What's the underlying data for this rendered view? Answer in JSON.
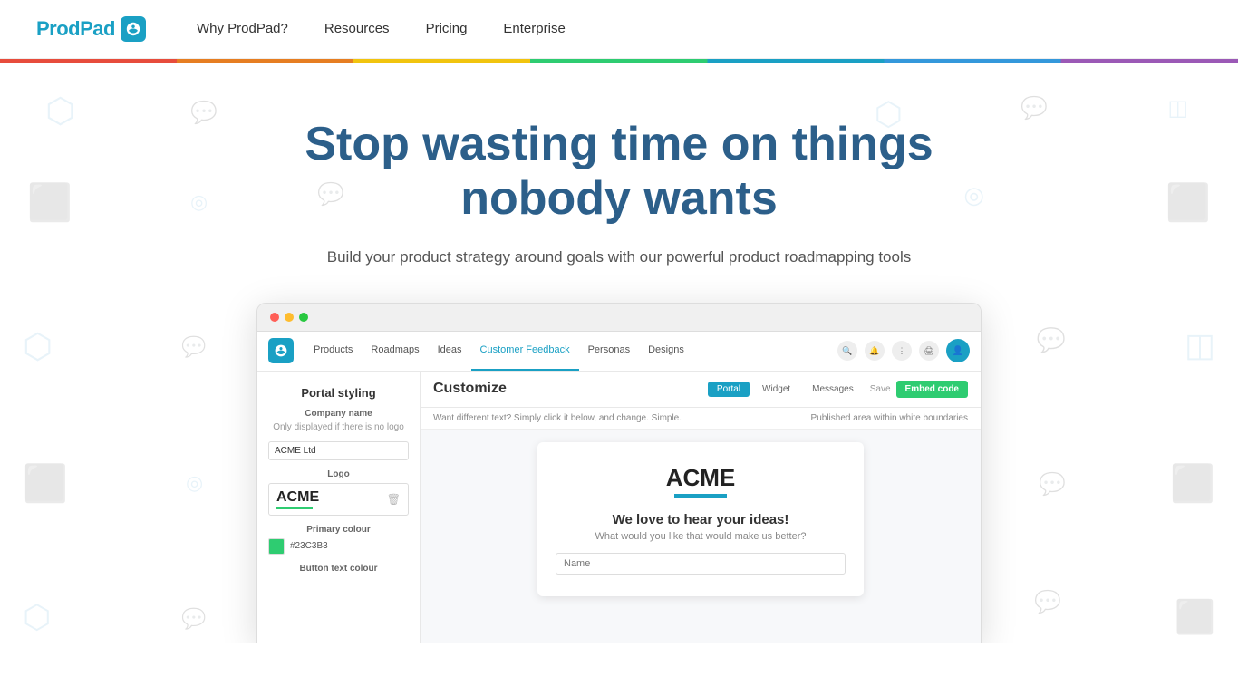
{
  "nav": {
    "logo_text": "ProdPad",
    "links": [
      {
        "label": "Why ProdPad?",
        "id": "why-prodpad"
      },
      {
        "label": "Resources",
        "id": "resources"
      },
      {
        "label": "Pricing",
        "id": "pricing"
      },
      {
        "label": "Enterprise",
        "id": "enterprise"
      }
    ]
  },
  "hero": {
    "title": "Stop wasting time on things nobody wants",
    "subtitle": "Build your product strategy around goals with our powerful product roadmapping tools"
  },
  "app_screenshot": {
    "nav_items": [
      {
        "label": "Products",
        "active": false
      },
      {
        "label": "Roadmaps",
        "active": false
      },
      {
        "label": "Ideas",
        "active": false
      },
      {
        "label": "Customer Feedback",
        "active": true
      },
      {
        "label": "Personas",
        "active": false
      },
      {
        "label": "Designs",
        "active": false
      }
    ],
    "sidebar": {
      "title": "Portal styling",
      "company_name_label": "Company name",
      "company_name_hint": "Only displayed if there is no logo",
      "company_name_value": "ACME Ltd",
      "logo_label": "Logo",
      "acme_text": "ACME",
      "primary_colour_label": "Primary colour",
      "primary_colour_hex": "#23C3B3",
      "button_text_label": "Button text colour"
    },
    "customize": {
      "title": "Customize",
      "tabs": [
        "Portal",
        "Widget",
        "Messages"
      ],
      "active_tab": "Portal",
      "save_label": "Save",
      "embed_label": "Embed code",
      "hint_left": "Want different text? Simply click it below, and change. Simple.",
      "hint_right": "Published area within white boundaries"
    },
    "portal_preview": {
      "acme_logo": "ACME",
      "heading": "We love to hear your ideas!",
      "subheading": "What would you like that would make us better?",
      "name_placeholder": "Name"
    }
  }
}
